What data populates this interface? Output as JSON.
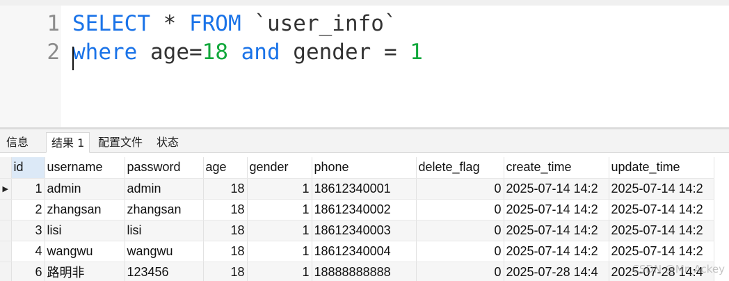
{
  "editor": {
    "lines": [
      {
        "number": "1",
        "tokens": {
          "select": "SELECT",
          "star": " * ",
          "from": "FROM",
          "table": " `user_info`"
        }
      },
      {
        "number": "2",
        "tokens": {
          "where": "where",
          "age": " age=",
          "age_val": "18",
          "and": " and",
          "gender": " gender = ",
          "gender_val": "1"
        }
      }
    ]
  },
  "tabs": [
    {
      "label": "信息"
    },
    {
      "label": "结果 1"
    },
    {
      "label": "配置文件"
    },
    {
      "label": "状态"
    }
  ],
  "grid": {
    "columns": [
      "id",
      "username",
      "password",
      "age",
      "gender",
      "phone",
      "delete_flag",
      "create_time",
      "update_time"
    ],
    "rows": [
      [
        "1",
        "admin",
        "admin",
        "18",
        "1",
        "18612340001",
        "0",
        "2025-07-14 14:2",
        "2025-07-14 14:2"
      ],
      [
        "2",
        "zhangsan",
        "zhangsan",
        "18",
        "1",
        "18612340002",
        "0",
        "2025-07-14 14:2",
        "2025-07-14 14:2"
      ],
      [
        "3",
        "lisi",
        "lisi",
        "18",
        "1",
        "18612340003",
        "0",
        "2025-07-14 14:2",
        "2025-07-14 14:2"
      ],
      [
        "4",
        "wangwu",
        "wangwu",
        "18",
        "1",
        "18612340004",
        "0",
        "2025-07-14 14:2",
        "2025-07-14 14:2"
      ],
      [
        "6",
        "路明非",
        "123456",
        "18",
        "1",
        "18888888888",
        "0",
        "2025-07-28 14:4",
        "2025-07-28 14:4"
      ]
    ],
    "current_row_marker": "▶"
  },
  "watermark": "CSDN @Mr_Ackey"
}
